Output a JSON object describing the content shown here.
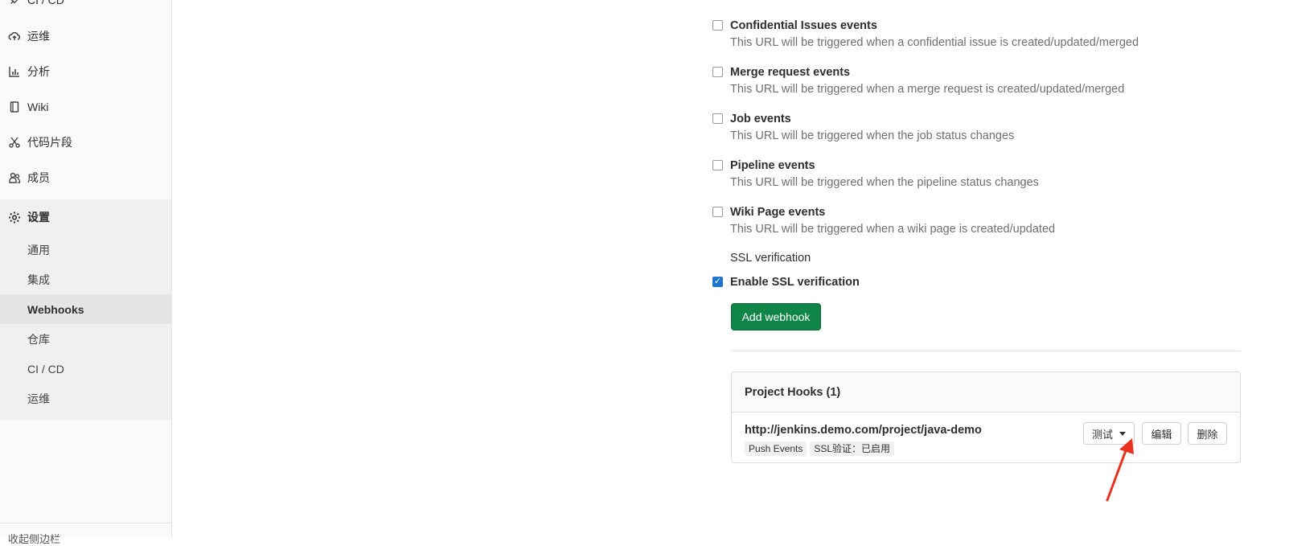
{
  "sidebar": {
    "top_partial": "CI / CD",
    "items": [
      {
        "label": "运维",
        "icon": "cloud-upload-icon"
      },
      {
        "label": "分析",
        "icon": "chart-icon"
      },
      {
        "label": "Wiki",
        "icon": "book-icon"
      },
      {
        "label": "代码片段",
        "icon": "scissors-icon"
      },
      {
        "label": "成员",
        "icon": "users-icon"
      },
      {
        "label": "设置",
        "icon": "gear-icon"
      }
    ],
    "sub_items": [
      {
        "label": "通用"
      },
      {
        "label": "集成"
      },
      {
        "label": "Webhooks"
      },
      {
        "label": "仓库"
      },
      {
        "label": "CI / CD"
      },
      {
        "label": "运维"
      }
    ],
    "bottom_partial": "收起侧边栏"
  },
  "events": [
    {
      "title": "Confidential Issues events",
      "desc": "This URL will be triggered when a confidential issue is created/updated/merged",
      "checked": false
    },
    {
      "title": "Merge request events",
      "desc": "This URL will be triggered when a merge request is created/updated/merged",
      "checked": false
    },
    {
      "title": "Job events",
      "desc": "This URL will be triggered when the job status changes",
      "checked": false
    },
    {
      "title": "Pipeline events",
      "desc": "This URL will be triggered when the pipeline status changes",
      "checked": false
    },
    {
      "title": "Wiki Page events",
      "desc": "This URL will be triggered when a wiki page is created/updated",
      "checked": false
    }
  ],
  "ssl": {
    "heading": "SSL verification",
    "label": "Enable SSL verification",
    "checked": true
  },
  "add_button": "Add webhook",
  "hooks": {
    "header": "Project Hooks (1)",
    "url": "http://jenkins.demo.com/project/java-demo",
    "badges": [
      "Push Events",
      "SSL验证：已启用"
    ],
    "test_button": "测试",
    "edit_button": "编辑",
    "delete_button": "删除"
  },
  "colors": {
    "primary_green": "#108548",
    "checkbox_blue": "#1f75cb",
    "arrow_red": "#e8321f"
  }
}
